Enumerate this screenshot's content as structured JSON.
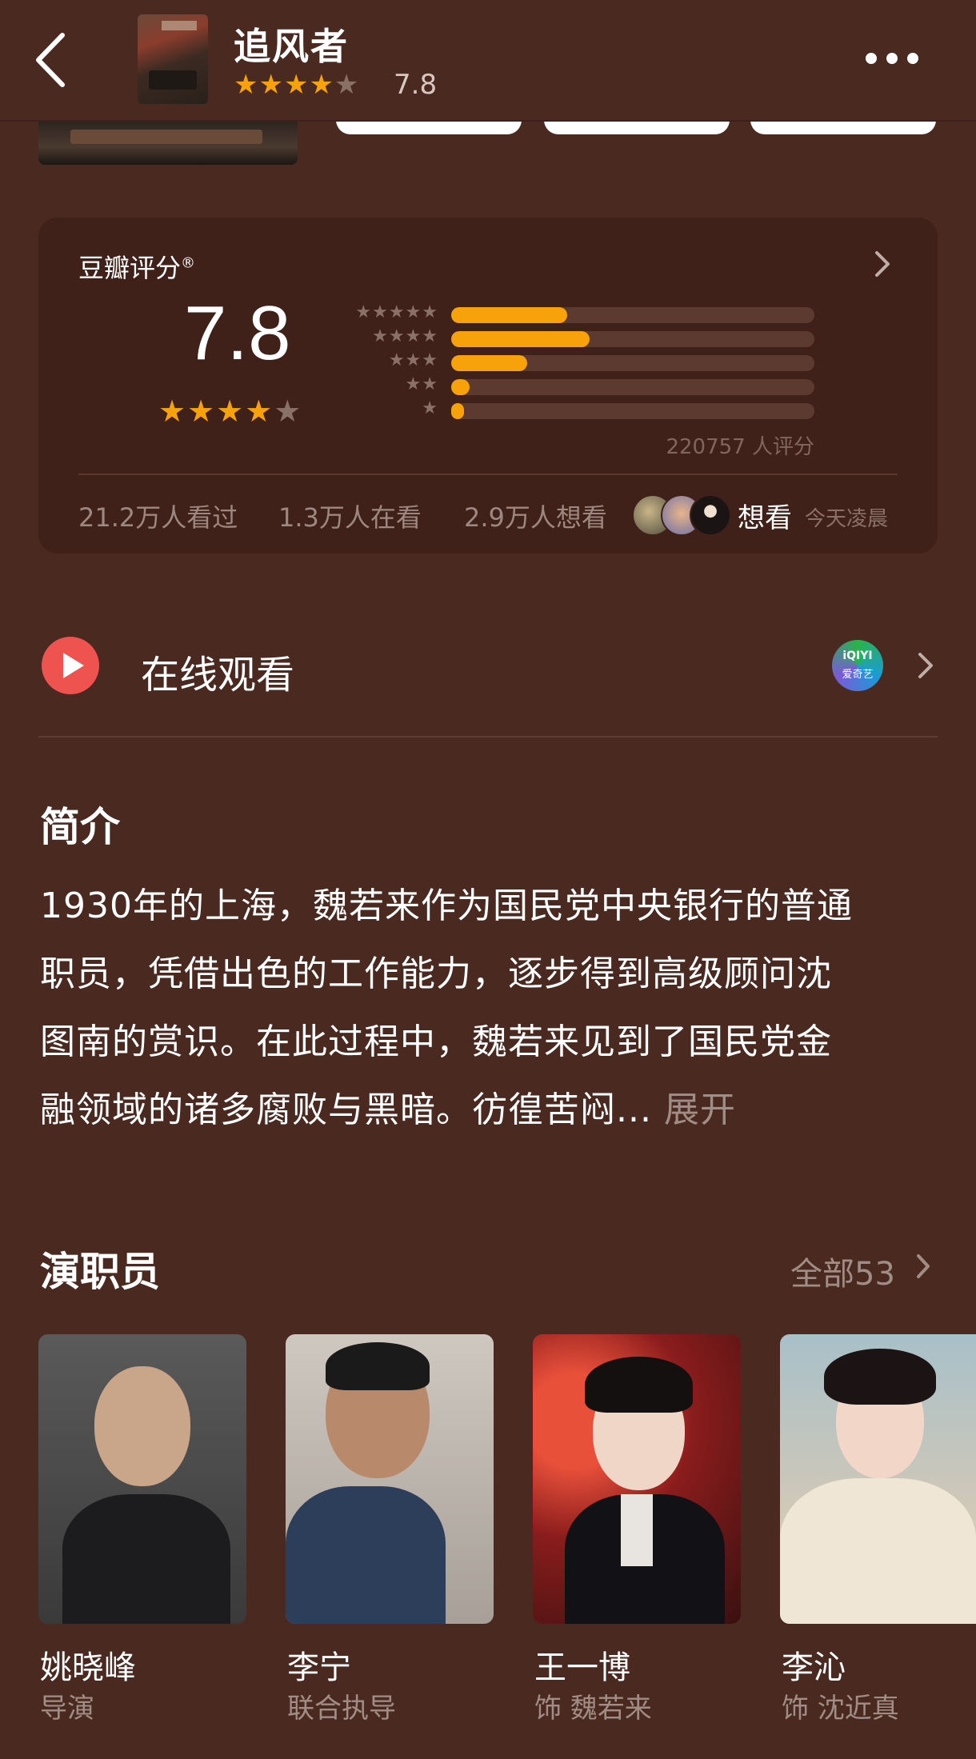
{
  "header": {
    "title": "追风者",
    "stars": "★★★★★",
    "score": "7.8"
  },
  "rating": {
    "title": "豆瓣评分",
    "registered_mark": "®",
    "score": "7.8",
    "stars": "★★★★★",
    "distribution": [
      {
        "stars": "★★★★★",
        "fraction": 0.32
      },
      {
        "stars": "★★★★",
        "fraction": 0.38
      },
      {
        "stars": "★★★",
        "fraction": 0.21
      },
      {
        "stars": "★★",
        "fraction": 0.05
      },
      {
        "stars": "★",
        "fraction": 0.035
      }
    ],
    "votes": "220757 人评分",
    "watched": "21.2万人看过",
    "watching": "1.3万人在看",
    "wish": "2.9万人想看",
    "want_label": "想看",
    "want_time": "今天凌晨"
  },
  "watch": {
    "label": "在线观看",
    "provider_logo_top": "iQIYI",
    "provider_logo_bottom": "爱奇艺"
  },
  "intro": {
    "title": "简介",
    "lines": [
      "1930年的上海，魏若来作为国民党中央银行的普通",
      "职员，凭借出色的工作能力，逐步得到高级顾问沈",
      "图南的赏识。在此过程中，魏若来见到了国民党金",
      "融领域的诸多腐败与黑暗。彷徨苦闷..."
    ],
    "expand": "展开"
  },
  "cast": {
    "title": "演职员",
    "all": "全部53",
    "members": [
      {
        "name": "姚晓峰",
        "role": "导演"
      },
      {
        "name": "李宁",
        "role": "联合执导"
      },
      {
        "name": "王一博",
        "role": "饰 魏若来"
      },
      {
        "name": "李沁",
        "role": "饰 沈近真"
      }
    ]
  },
  "colors": {
    "background": "#4a2a20",
    "card": "#3f2119",
    "accent_star": "#f7a20a",
    "play": "#ef5350"
  }
}
